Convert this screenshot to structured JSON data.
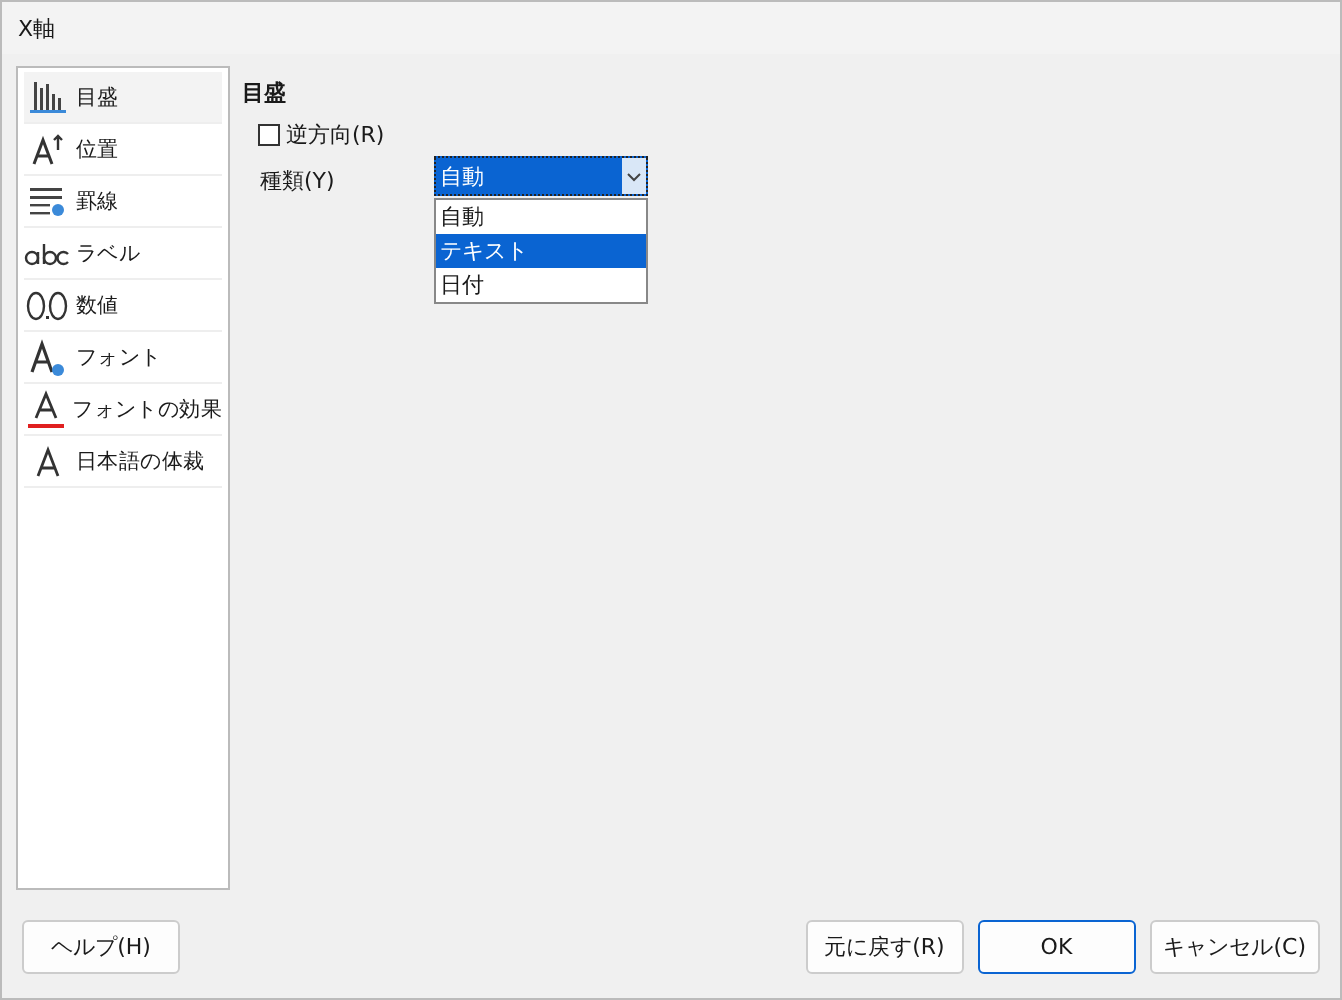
{
  "window": {
    "title": "X軸"
  },
  "sidebar": {
    "items": [
      {
        "label": "目盛",
        "kind": "scale",
        "selected": true
      },
      {
        "label": "位置",
        "kind": "position",
        "selected": false
      },
      {
        "label": "罫線",
        "kind": "lines",
        "selected": false
      },
      {
        "label": "ラベル",
        "kind": "abc",
        "selected": false
      },
      {
        "label": "数値",
        "kind": "number",
        "selected": false
      },
      {
        "label": "フォント",
        "kind": "font",
        "selected": false
      },
      {
        "label": "フォントの効果",
        "kind": "effects",
        "selected": false
      },
      {
        "label": "日本語の体裁",
        "kind": "asian",
        "selected": false
      }
    ]
  },
  "section": {
    "heading": "目盛",
    "reverse": {
      "label": "逆方向(R)",
      "checked": false
    },
    "type": {
      "label": "種類(Y)",
      "value": "自動",
      "options": [
        {
          "label": "自動",
          "highlighted": false
        },
        {
          "label": "テキスト",
          "highlighted": true
        },
        {
          "label": "日付",
          "highlighted": false
        }
      ]
    }
  },
  "buttons": {
    "left": [
      {
        "label": "ヘルプ(H)",
        "default": false
      }
    ],
    "right": [
      {
        "label": "元に戻す(R)",
        "default": false
      },
      {
        "label": "OK",
        "default": true
      },
      {
        "label": "キャンセル(C)",
        "default": false
      }
    ]
  }
}
